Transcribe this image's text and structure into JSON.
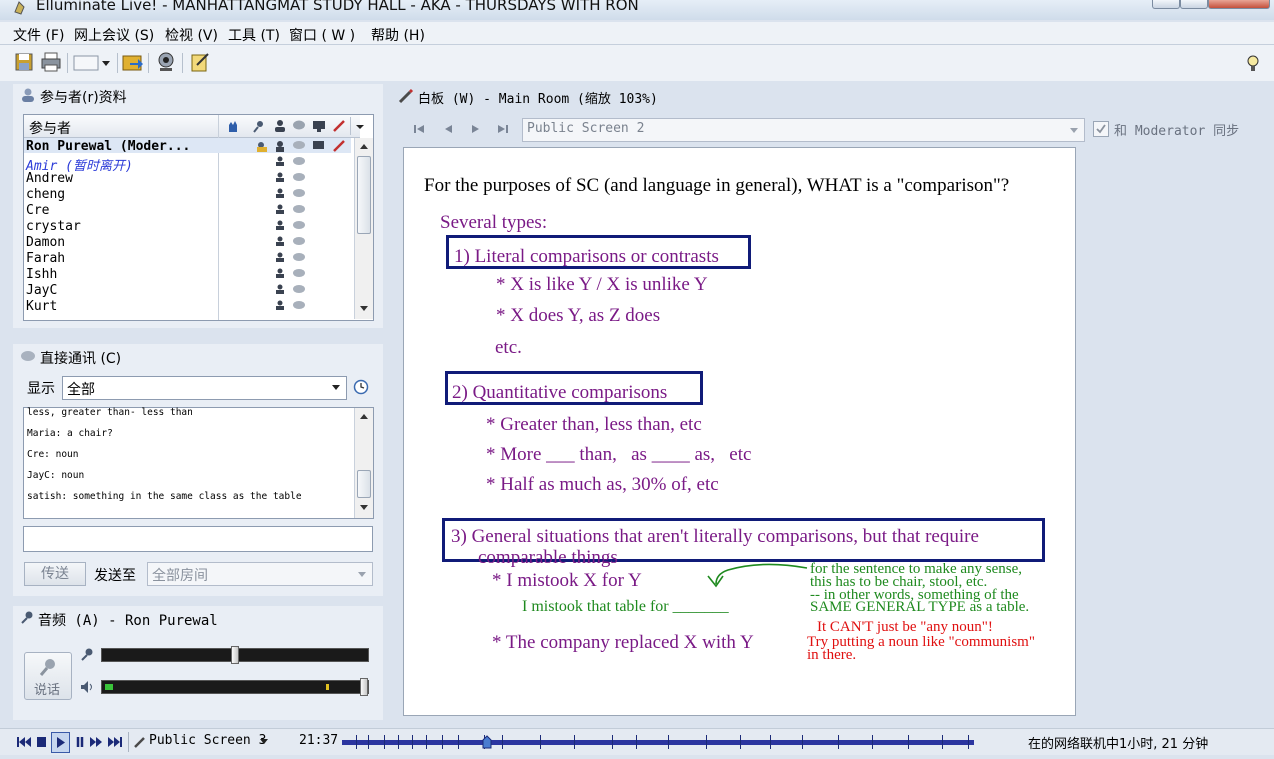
{
  "window": {
    "title": "Elluminate Live! - MANHATTANGMAT STUDY HALL - AKA - THURSDAYS WITH RON"
  },
  "menu": [
    "文件 (F)",
    "网上会议 (S)",
    "检视 (V)",
    "工具 (T)",
    "窗口 ( W )",
    "帮助 (H)"
  ],
  "participants": {
    "panel_title": "参与者(r)资料",
    "column_header": "参与者",
    "items": [
      "Ron Purewal (Moder...",
      "Amir (暂时离开)",
      "Andrew",
      "cheng",
      "Cre",
      "crystar",
      "Damon",
      "Farah",
      "Ishh",
      "JayC",
      "Kurt"
    ]
  },
  "chat": {
    "panel_title": "直接通讯 (C)",
    "show_label": "显示",
    "filter_value": "全部",
    "messages": [
      "less, greater than- less than",
      "Maria: a chair?",
      "Cre: noun",
      "JayC: noun",
      "satish: something in the same class as the table"
    ],
    "input_value": "",
    "send_label": "传送",
    "send_to_label": "发送至",
    "send_to_value": "全部房间"
  },
  "audio": {
    "panel_title": "音频 (A) - Ron Purewal",
    "talk_label": "说话",
    "mic_level": 0.5,
    "speaker_volume": 1.0
  },
  "whiteboard": {
    "panel_title": "白板 (W) - Main Room (缩放 103%)",
    "screen_value": "Public Screen 2",
    "sync_label": "和 Moderator 同步",
    "sync_checked": true,
    "content": {
      "heading": "For the purposes of SC (and language in general), WHAT is a \"comparison\"?",
      "several": "Several types:",
      "s1": "1) Literal comparisons or contrasts",
      "s1a": "* X is like Y / X is unlike Y",
      "s1b": "* X does Y, as Z does",
      "s1c": "etc.",
      "s2": "2) Quantitative comparisons",
      "s2a": "* Greater than, less than, etc",
      "s2b": "* More ___ than,   as ____ as,   etc",
      "s2c": "* Half as much as, 30% of, etc",
      "s3a": "3) General situations that aren't literally comparisons, but that require",
      "s3b": "comparable things",
      "ex1": "* I mistook X for Y",
      "ex1b": "I mistook that table for _______",
      "ex2": "* The company replaced X with Y",
      "g1": "for the sentence to make any sense,",
      "g2": "this has to be chair, stool, etc.",
      "g3": "-- in other words, something of the",
      "g4": "SAME GENERAL TYPE as a table.",
      "r1": "It CAN'T just be \"any noun\"!",
      "r2": "Try putting a noun like \"communism\"",
      "r3": "in there."
    }
  },
  "playback": {
    "screen_label": "Public Screen 3",
    "time": "21:37",
    "status": "在的网络联机中1小时, 21 分钟"
  },
  "colors": {
    "purple": "#7a1a86",
    "green": "#1f8a1f",
    "red": "#e01010",
    "box": "#101b78",
    "progress": "#2b35a0"
  }
}
